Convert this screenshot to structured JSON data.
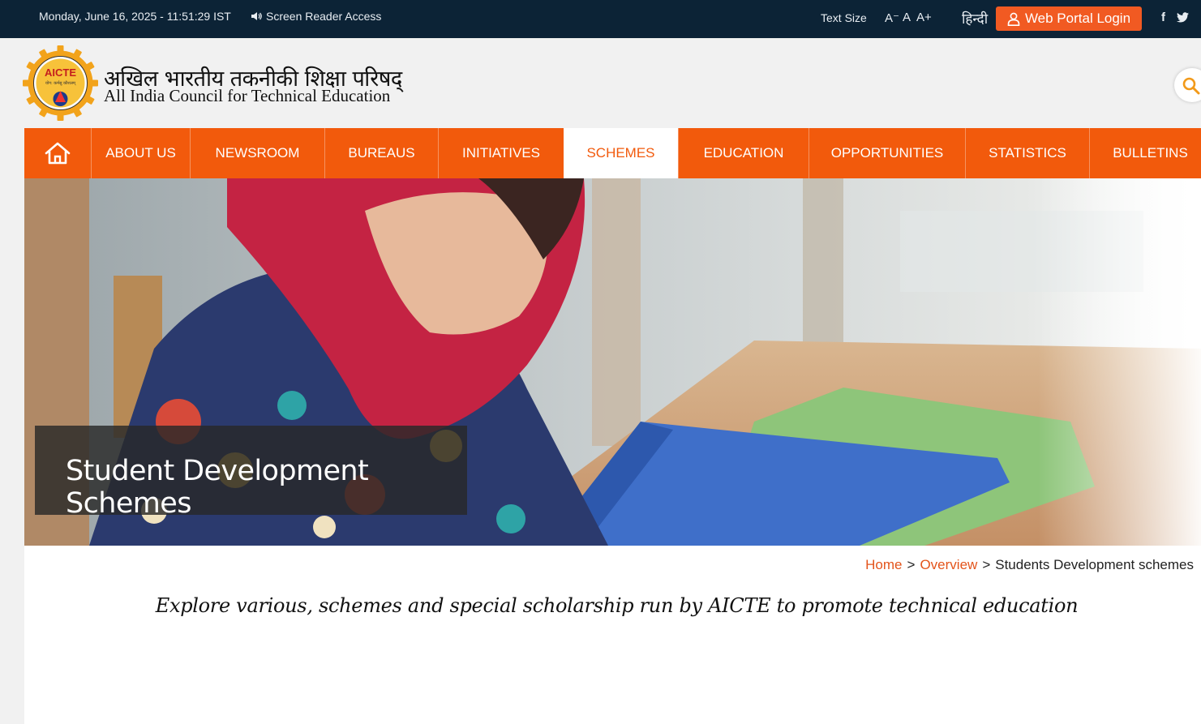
{
  "topbar": {
    "datetime": "Monday, June 16, 2025 - 11:51:29 IST",
    "screen_reader": "Screen Reader Access",
    "text_size_label": "Text Size",
    "text_size_decrease": "A⁻",
    "text_size_normal": "A",
    "text_size_increase": "A+",
    "hindi_link": "हिन्दी",
    "login_label": "Web Portal Login",
    "social": {
      "facebook": "f",
      "twitter_icon": "twitter-icon"
    }
  },
  "header": {
    "logo_text": "AICTE",
    "logo_subtext": "योग: कर्मसु कौशलम्",
    "title_hindi": "अखिल भारतीय तकनीकी शिक्षा परिषद्",
    "title_english": "All India Council for Technical Education",
    "search_icon": "search-icon"
  },
  "nav": {
    "home_icon": "home-icon",
    "items": [
      "ABOUT US",
      "NEWSROOM",
      "BUREAUS",
      "INITIATIVES",
      "SCHEMES",
      "EDUCATION",
      "OPPORTUNITIES",
      "STATISTICS",
      "BULLETINS"
    ],
    "active": "SCHEMES"
  },
  "hero": {
    "caption": "Student Development Schemes"
  },
  "breadcrumb": {
    "home": "Home",
    "overview": "Overview",
    "current": "Students Development schemes",
    "separator": ">"
  },
  "tagline": "Explore various, schemes and special scholarship run by AICTE to promote technical education",
  "colors": {
    "topbar": "#0c2336",
    "accent": "#f25a0c",
    "link": "#e3541b"
  }
}
